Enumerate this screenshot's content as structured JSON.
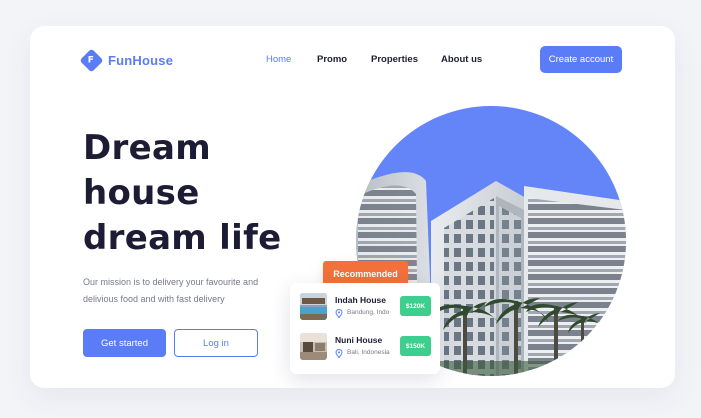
{
  "brand": {
    "name": "FunHouse",
    "mark": "F",
    "accent": "#5b7cf7"
  },
  "nav": {
    "items": [
      {
        "label": "Home",
        "active": true
      },
      {
        "label": "Promo",
        "active": false
      },
      {
        "label": "Properties",
        "active": false
      },
      {
        "label": "About us",
        "active": false
      }
    ],
    "cta": "Create account"
  },
  "hero": {
    "title_lines": [
      "Dream",
      "house",
      "dream life"
    ],
    "description": "Our mission is to delivery your favourite and delivious food and with fast delivery",
    "primary_button": "Get started",
    "secondary_button": "Log in"
  },
  "recommended": {
    "label": "Recommended",
    "items": [
      {
        "name": "Indah House",
        "location": "Bandung, Indo",
        "price": "$120K"
      },
      {
        "name": "Nuni House",
        "location": "Bali, Indonesia",
        "price": "$150K"
      }
    ]
  },
  "colors": {
    "primary": "#5b7cf7",
    "orange": "#f2703a",
    "green": "#3ccf8e",
    "dark": "#1c1d35"
  },
  "icons": [
    "logo-diamond-icon",
    "location-pin-icon"
  ]
}
